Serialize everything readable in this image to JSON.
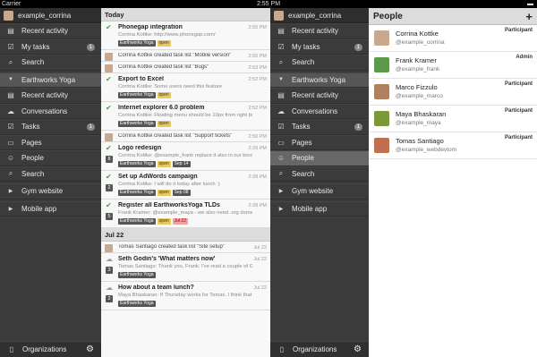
{
  "status": {
    "carrier": "Carrier",
    "time": "2:55 PM",
    "battery": "▬"
  },
  "sidebar1": {
    "user": "example_corrina",
    "top_items": [
      {
        "icon": "▤",
        "label": "Recent activity",
        "badge": ""
      },
      {
        "icon": "☑",
        "label": "My tasks",
        "badge": "1"
      },
      {
        "icon": "⌕",
        "label": "Search",
        "badge": ""
      }
    ],
    "project": "Earthworks Yoga",
    "project_items": [
      {
        "icon": "▤",
        "label": "Recent activity",
        "badge": ""
      },
      {
        "icon": "☁",
        "label": "Conversations",
        "badge": ""
      },
      {
        "icon": "☑",
        "label": "Tasks",
        "badge": "1"
      },
      {
        "icon": "▭",
        "label": "Pages",
        "badge": ""
      },
      {
        "icon": "☺",
        "label": "People",
        "badge": ""
      },
      {
        "icon": "⌕",
        "label": "Search",
        "badge": ""
      }
    ],
    "other_projects": [
      "Gym website",
      "Mobile app"
    ],
    "bottom": "Organizations"
  },
  "sidebar2": {
    "user": "example_corrina",
    "top_items": [
      {
        "icon": "▤",
        "label": "Recent activity",
        "badge": ""
      },
      {
        "icon": "☑",
        "label": "My tasks",
        "badge": "1"
      },
      {
        "icon": "⌕",
        "label": "Search",
        "badge": ""
      }
    ],
    "project": "Earthworks Yoga",
    "project_items": [
      {
        "icon": "▤",
        "label": "Recent activity",
        "badge": ""
      },
      {
        "icon": "☁",
        "label": "Conversations",
        "badge": ""
      },
      {
        "icon": "☑",
        "label": "Tasks",
        "badge": "1"
      },
      {
        "icon": "▭",
        "label": "Pages",
        "badge": ""
      },
      {
        "icon": "☺",
        "label": "People",
        "badge": ""
      },
      {
        "icon": "⌕",
        "label": "Search",
        "badge": ""
      }
    ],
    "other_projects": [
      "Gym website",
      "Mobile app"
    ],
    "bottom": "Organizations"
  },
  "activity": {
    "day1": "Today",
    "rows1": [
      {
        "kind": "check",
        "title": "Phonegap integration",
        "sub": "Corrina Kottke: http://www.phonegap.com/",
        "time": "2:55 PM",
        "tags": [
          "Earthworks Yoga",
          "open"
        ],
        "num": ""
      },
      {
        "kind": "avatar",
        "title": "Corrina Kottke created task list \"Mobile version\"",
        "sub": "",
        "time": "2:55 PM",
        "tags": [],
        "num": ""
      },
      {
        "kind": "avatar",
        "title": "Corrina Kottke created task list \"Bugs\"",
        "sub": "",
        "time": "2:53 PM",
        "tags": [],
        "num": ""
      },
      {
        "kind": "check",
        "title": "Export to Excel",
        "sub": "Corrina Kottke: Some users need this feature",
        "time": "2:52 PM",
        "tags": [
          "Earthworks Yoga",
          "open"
        ],
        "num": ""
      },
      {
        "kind": "check",
        "title": "Internet explorer 6.0 problem",
        "sub": "Corrina Kottke: Floating menu should be 10px from right border.",
        "time": "2:52 PM",
        "tags": [
          "Earthworks Yoga",
          "open"
        ],
        "num": ""
      },
      {
        "kind": "avatar",
        "title": "Corrina Kottke created task list \"Support tickets\"",
        "sub": "",
        "time": "2:50 PM",
        "tags": [],
        "num": ""
      },
      {
        "kind": "check",
        "title": "Logo redesign",
        "sub": "Corrina Kottke: @example_frank replace it also in our brochure.",
        "time": "2:29 PM",
        "tags": [
          "Earthworks Yoga",
          "open",
          "Sep 14"
        ],
        "num": "8"
      },
      {
        "kind": "check",
        "title": "Set up AdWords campaign",
        "sub": "Corrina Kottke: I will do it today after lunch :)",
        "time": "2:28 PM",
        "tags": [
          "Earthworks Yoga",
          "open",
          "Sep 08"
        ],
        "num": "2"
      },
      {
        "kind": "check",
        "title": "Register all EarthworksYoga TLDs",
        "sub": "Frank Kramer: @example_maya - we also need .org domain",
        "time": "2:28 PM",
        "tags": [
          "Earthworks Yoga",
          "open",
          "Jul 22"
        ],
        "num": "5"
      }
    ],
    "day2": "Jul 22",
    "rows2": [
      {
        "kind": "avatar",
        "title": "Tomas Santiago created task list \"Site setup\"",
        "sub": "",
        "time": "Jul 22",
        "tags": [],
        "num": ""
      },
      {
        "kind": "convo",
        "title": "Seth Godin's 'What matters now'",
        "sub": "Tomas Santiago: Thank you, Frank. I've read a couple of Godin's...",
        "time": "Jul 22",
        "tags": [
          "Earthworks Yoga"
        ],
        "num": "3"
      },
      {
        "kind": "convo",
        "title": "How about a team lunch?",
        "sub": "Maya Bhaskaran: If Thursday works for Tomas, I think that will...",
        "time": "Jul 22",
        "tags": [
          "Earthworks Yoga"
        ],
        "num": "2"
      }
    ]
  },
  "people": {
    "title": "People",
    "add": "+",
    "list": [
      {
        "name": "Corrina Kottke",
        "handle": "@example_corrina",
        "role": "Participant",
        "color": "#c9a98e"
      },
      {
        "name": "Frank Kramer",
        "handle": "@example_frank",
        "role": "Admin",
        "color": "#5a9a4a"
      },
      {
        "name": "Marco Fizzulo",
        "handle": "@example_marco",
        "role": "Participant",
        "color": "#b08060"
      },
      {
        "name": "Maya Bhaskaran",
        "handle": "@example_maya",
        "role": "Participant",
        "color": "#7a9a3a"
      },
      {
        "name": "Tomas Santiago",
        "handle": "@example_webdevtom",
        "role": "Participant",
        "color": "#c07050"
      }
    ]
  }
}
